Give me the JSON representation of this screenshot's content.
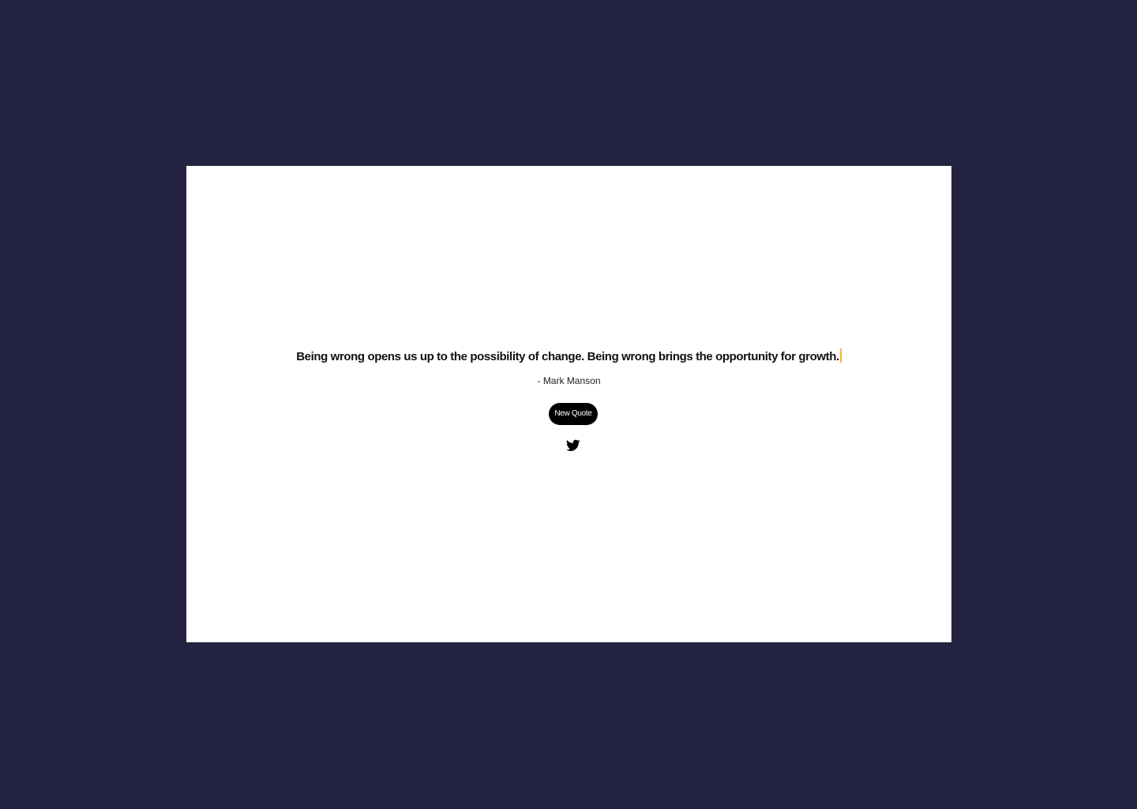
{
  "quote": {
    "text": "Being wrong opens us up to the possibility of change. Being wrong brings the opportunity for growth.",
    "author": "- Mark Manson"
  },
  "actions": {
    "new_quote_label": "New Quote",
    "tweet_icon": "twitter-bird-icon"
  },
  "colors": {
    "background": "#232241",
    "card": "#ffffff",
    "button": "#000000",
    "cursor_accent": "#f2b632"
  }
}
